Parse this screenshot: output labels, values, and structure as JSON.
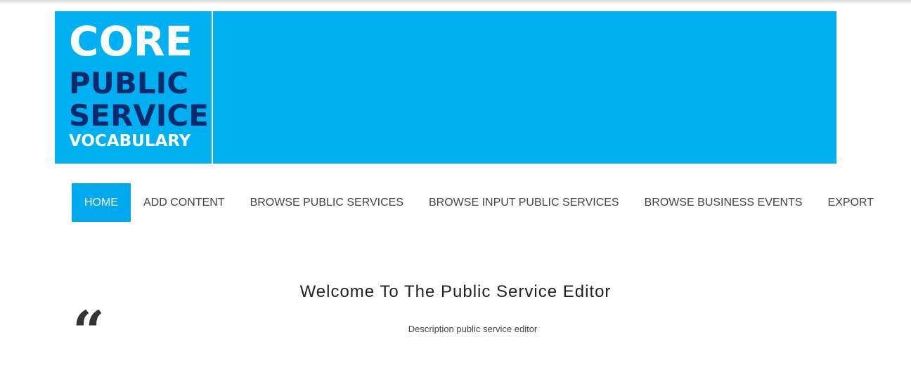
{
  "logo": {
    "line1": "CORE",
    "line2": "PUBLIC",
    "line3": "SERVICE",
    "line4": "VOCABULARY"
  },
  "nav": {
    "items": [
      {
        "label": "HOME",
        "active": true
      },
      {
        "label": "ADD CONTENT",
        "active": false
      },
      {
        "label": "BROWSE PUBLIC SERVICES",
        "active": false
      },
      {
        "label": "BROWSE INPUT PUBLIC SERVICES",
        "active": false
      },
      {
        "label": "BROWSE BUSINESS EVENTS",
        "active": false
      },
      {
        "label": "EXPORT",
        "active": false
      }
    ]
  },
  "main": {
    "title": "Welcome To The Public Service Editor",
    "quote_mark": "“",
    "description": "Description public service editor"
  },
  "colors": {
    "banner": "#00b0f0",
    "active_nav": "#00a9ec",
    "logo_dark": "#0a2a6e"
  }
}
